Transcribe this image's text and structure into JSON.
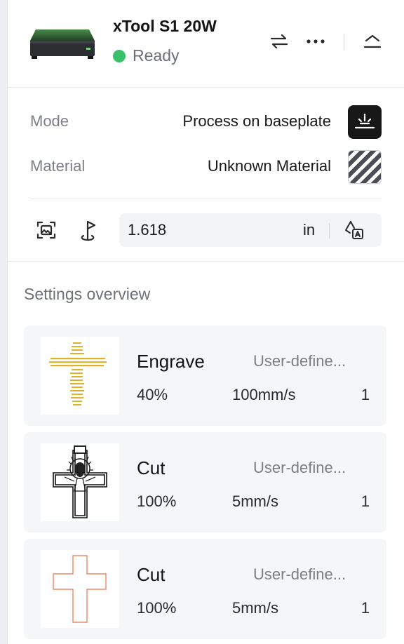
{
  "device": {
    "name": "xTool S1 20W",
    "status": "Ready",
    "status_color": "#39c06a"
  },
  "header_icons": [
    "switch-arrows-icon",
    "more-dots-icon",
    "collapse-icon"
  ],
  "mode": {
    "label": "Mode",
    "value": "Process on baseplate"
  },
  "material": {
    "label": "Material",
    "value": "Unknown Material"
  },
  "height": {
    "value": "1.618",
    "unit": "in"
  },
  "settings": {
    "title": "Settings overview",
    "cards": [
      {
        "type": "Engrave",
        "preset": "User-define...",
        "power": "40%",
        "speed": "100mm/s",
        "passes": "1"
      },
      {
        "type": "Cut",
        "preset": "User-define...",
        "power": "100%",
        "speed": "5mm/s",
        "passes": "1"
      },
      {
        "type": "Cut",
        "preset": "User-define...",
        "power": "100%",
        "speed": "5mm/s",
        "passes": "1"
      }
    ]
  },
  "colors": {
    "accent_dark": "#171717",
    "engrave_gold": "#e0b228",
    "cut_red": "#e8754f"
  }
}
